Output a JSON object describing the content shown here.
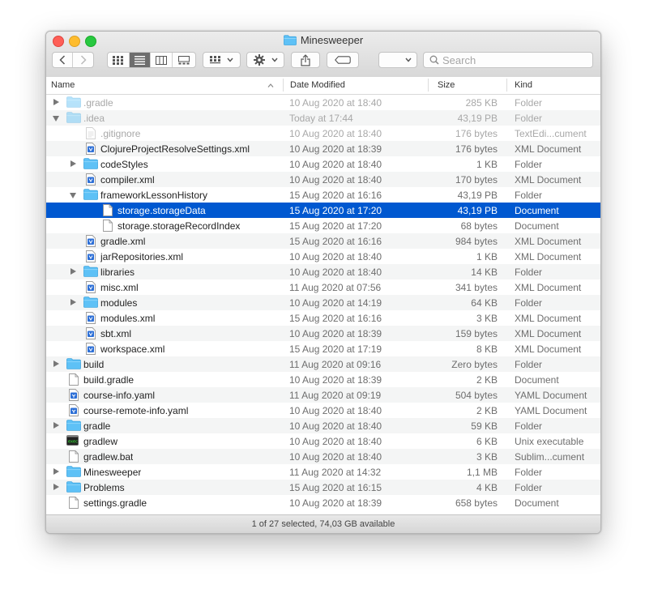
{
  "window": {
    "title": "Minesweeper"
  },
  "toolbar": {
    "search_placeholder": "Search"
  },
  "columns": {
    "name": "Name",
    "date": "Date Modified",
    "size": "Size",
    "kind": "Kind"
  },
  "status": "1 of 27 selected, 74,03 GB available",
  "colors": {
    "selection": "#0058d0",
    "folder": "#5ec1f6",
    "stripe": "#f4f5f5"
  },
  "rows": [
    {
      "name": ".gradle",
      "date": "10 Aug 2020 at 18:40",
      "size": "285 KB",
      "kind": "Folder",
      "level": 0,
      "icon": "folder-icon",
      "disclosure": "collapsed",
      "dim": true
    },
    {
      "name": ".idea",
      "date": "Today at 17:44",
      "size": "43,19 PB",
      "kind": "Folder",
      "level": 0,
      "icon": "folder-icon",
      "disclosure": "expanded",
      "dim": true
    },
    {
      "name": ".gitignore",
      "date": "10 Aug 2020 at 18:40",
      "size": "176 bytes",
      "kind": "TextEdi...cument",
      "level": 1,
      "icon": "text-file-icon",
      "disclosure": "none",
      "dim": true
    },
    {
      "name": "ClojureProjectResolveSettings.xml",
      "date": "10 Aug 2020 at 18:39",
      "size": "176 bytes",
      "kind": "XML Document",
      "level": 1,
      "icon": "xml-file-icon",
      "disclosure": "none"
    },
    {
      "name": "codeStyles",
      "date": "10 Aug 2020 at 18:40",
      "size": "1 KB",
      "kind": "Folder",
      "level": 1,
      "icon": "folder-icon",
      "disclosure": "collapsed"
    },
    {
      "name": "compiler.xml",
      "date": "10 Aug 2020 at 18:40",
      "size": "170 bytes",
      "kind": "XML Document",
      "level": 1,
      "icon": "xml-file-icon",
      "disclosure": "none"
    },
    {
      "name": "frameworkLessonHistory",
      "date": "15 Aug 2020 at 16:16",
      "size": "43,19 PB",
      "kind": "Folder",
      "level": 1,
      "icon": "folder-icon",
      "disclosure": "expanded"
    },
    {
      "name": "storage.storageData",
      "date": "15 Aug 2020 at 17:20",
      "size": "43,19 PB",
      "kind": "Document",
      "level": 2,
      "icon": "document-icon",
      "disclosure": "none",
      "selected": true
    },
    {
      "name": "storage.storageRecordIndex",
      "date": "15 Aug 2020 at 17:20",
      "size": "68 bytes",
      "kind": "Document",
      "level": 2,
      "icon": "document-icon",
      "disclosure": "none"
    },
    {
      "name": "gradle.xml",
      "date": "15 Aug 2020 at 16:16",
      "size": "984 bytes",
      "kind": "XML Document",
      "level": 1,
      "icon": "xml-file-icon",
      "disclosure": "none"
    },
    {
      "name": "jarRepositories.xml",
      "date": "10 Aug 2020 at 18:40",
      "size": "1 KB",
      "kind": "XML Document",
      "level": 1,
      "icon": "xml-file-icon",
      "disclosure": "none"
    },
    {
      "name": "libraries",
      "date": "10 Aug 2020 at 18:40",
      "size": "14 KB",
      "kind": "Folder",
      "level": 1,
      "icon": "folder-icon",
      "disclosure": "collapsed"
    },
    {
      "name": "misc.xml",
      "date": "11 Aug 2020 at 07:56",
      "size": "341 bytes",
      "kind": "XML Document",
      "level": 1,
      "icon": "xml-file-icon",
      "disclosure": "none"
    },
    {
      "name": "modules",
      "date": "10 Aug 2020 at 14:19",
      "size": "64 KB",
      "kind": "Folder",
      "level": 1,
      "icon": "folder-icon",
      "disclosure": "collapsed"
    },
    {
      "name": "modules.xml",
      "date": "15 Aug 2020 at 16:16",
      "size": "3 KB",
      "kind": "XML Document",
      "level": 1,
      "icon": "xml-file-icon",
      "disclosure": "none"
    },
    {
      "name": "sbt.xml",
      "date": "10 Aug 2020 at 18:39",
      "size": "159 bytes",
      "kind": "XML Document",
      "level": 1,
      "icon": "xml-file-icon",
      "disclosure": "none"
    },
    {
      "name": "workspace.xml",
      "date": "15 Aug 2020 at 17:19",
      "size": "8 KB",
      "kind": "XML Document",
      "level": 1,
      "icon": "xml-file-icon",
      "disclosure": "none"
    },
    {
      "name": "build",
      "date": "11 Aug 2020 at 09:16",
      "size": "Zero bytes",
      "kind": "Folder",
      "level": 0,
      "icon": "folder-icon",
      "disclosure": "collapsed"
    },
    {
      "name": "build.gradle",
      "date": "10 Aug 2020 at 18:39",
      "size": "2 KB",
      "kind": "Document",
      "level": 0,
      "icon": "document-icon",
      "disclosure": "none"
    },
    {
      "name": "course-info.yaml",
      "date": "11 Aug 2020 at 09:19",
      "size": "504 bytes",
      "kind": "YAML Document",
      "level": 0,
      "icon": "yaml-file-icon",
      "disclosure": "none"
    },
    {
      "name": "course-remote-info.yaml",
      "date": "10 Aug 2020 at 18:40",
      "size": "2 KB",
      "kind": "YAML Document",
      "level": 0,
      "icon": "yaml-file-icon",
      "disclosure": "none"
    },
    {
      "name": "gradle",
      "date": "10 Aug 2020 at 18:40",
      "size": "59 KB",
      "kind": "Folder",
      "level": 0,
      "icon": "folder-icon",
      "disclosure": "collapsed"
    },
    {
      "name": "gradlew",
      "date": "10 Aug 2020 at 18:40",
      "size": "6 KB",
      "kind": "Unix executable",
      "level": 0,
      "icon": "terminal-exec-icon",
      "disclosure": "none"
    },
    {
      "name": "gradlew.bat",
      "date": "10 Aug 2020 at 18:40",
      "size": "3 KB",
      "kind": "Sublim...cument",
      "level": 0,
      "icon": "document-icon",
      "disclosure": "none"
    },
    {
      "name": "Minesweeper",
      "date": "11 Aug 2020 at 14:32",
      "size": "1,1 MB",
      "kind": "Folder",
      "level": 0,
      "icon": "folder-icon",
      "disclosure": "collapsed"
    },
    {
      "name": "Problems",
      "date": "15 Aug 2020 at 16:15",
      "size": "4 KB",
      "kind": "Folder",
      "level": 0,
      "icon": "folder-icon",
      "disclosure": "collapsed"
    },
    {
      "name": "settings.gradle",
      "date": "10 Aug 2020 at 18:39",
      "size": "658 bytes",
      "kind": "Document",
      "level": 0,
      "icon": "document-icon",
      "disclosure": "none"
    }
  ]
}
